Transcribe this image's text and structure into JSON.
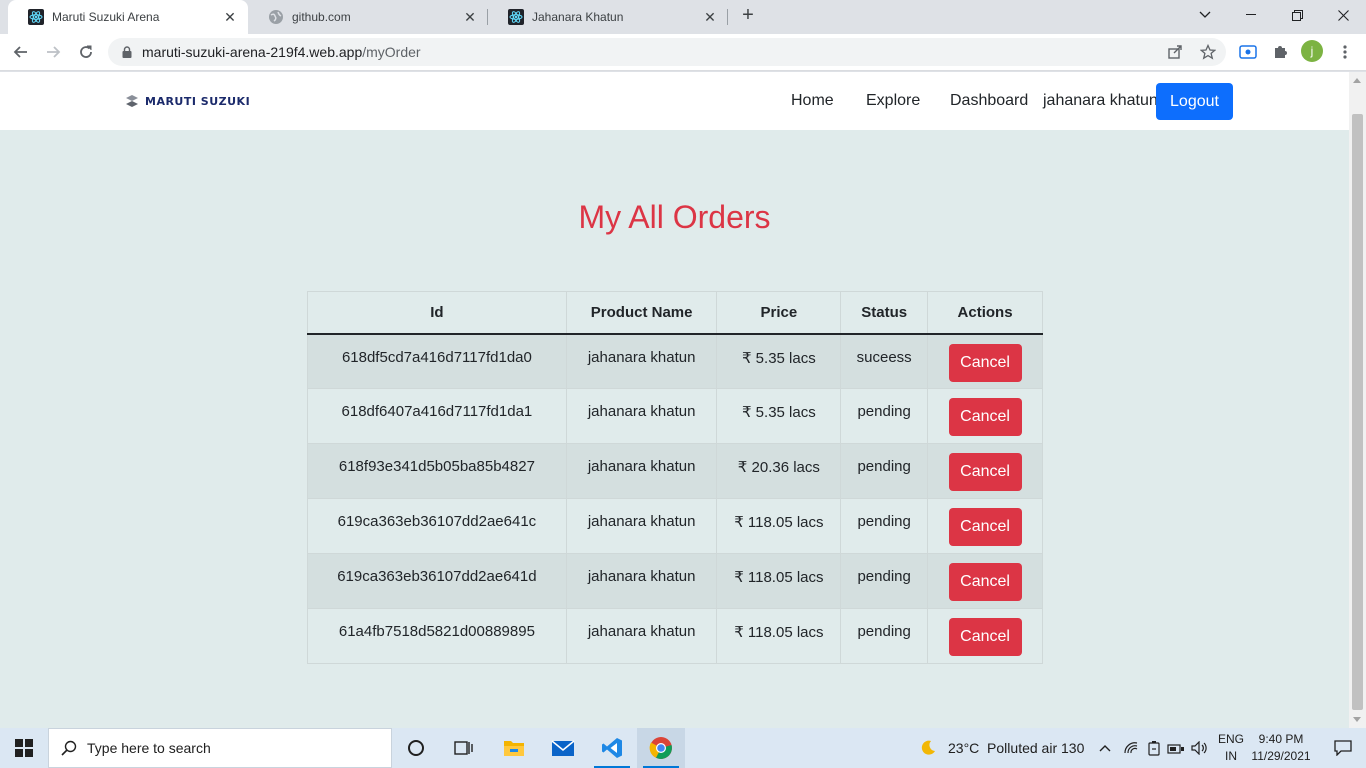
{
  "browser": {
    "tabs": [
      {
        "title": "Maruti Suzuki Arena",
        "icon": "react-icon",
        "active": true
      },
      {
        "title": "github.com",
        "icon": "globe-icon",
        "active": false
      },
      {
        "title": "Jahanara Khatun",
        "icon": "react-icon",
        "active": false
      }
    ],
    "url_host": "maruti-suzuki-arena-219f4.web.app",
    "url_path": "/myOrder",
    "profile_initial": "j"
  },
  "site": {
    "brand": "MARUTI SUZUKI",
    "nav": {
      "home": "Home",
      "explore": "Explore",
      "dashboard": "Dashboard",
      "user": "jahanara khatun",
      "logout": "Logout"
    },
    "heading": "My All Orders",
    "table": {
      "headers": [
        "Id",
        "Product Name",
        "Price",
        "Status",
        "Actions"
      ],
      "rows": [
        {
          "id": "618df5cd7a416d7117fd1da0",
          "product": "jahanara khatun",
          "price": "₹ 5.35 lacs",
          "status": "suceess",
          "action": "Cancel"
        },
        {
          "id": "618df6407a416d7117fd1da1",
          "product": "jahanara khatun",
          "price": "₹ 5.35 lacs",
          "status": "pending",
          "action": "Cancel"
        },
        {
          "id": "618f93e341d5b05ba85b4827",
          "product": "jahanara khatun",
          "price": "₹ 20.36 lacs",
          "status": "pending",
          "action": "Cancel"
        },
        {
          "id": "619ca363eb36107dd2ae641c",
          "product": "jahanara khatun",
          "price": "₹ 118.05 lacs",
          "status": "pending",
          "action": "Cancel"
        },
        {
          "id": "619ca363eb36107dd2ae641d",
          "product": "jahanara khatun",
          "price": "₹ 118.05 lacs",
          "status": "pending",
          "action": "Cancel"
        },
        {
          "id": "61a4fb7518d5821d00889895",
          "product": "jahanara khatun",
          "price": "₹ 118.05 lacs",
          "status": "pending",
          "action": "Cancel"
        }
      ]
    },
    "colors": {
      "heading": "#dc3545",
      "cancel": "#dc3545",
      "logout": "#0d6efd",
      "page_bg": "#e0ebeb"
    }
  },
  "taskbar": {
    "search_placeholder": "Type here to search",
    "weather": "23°C  Polluted air 130",
    "lang_line1": "ENG",
    "lang_line2": "IN",
    "time": "9:40 PM",
    "date": "11/29/2021"
  }
}
